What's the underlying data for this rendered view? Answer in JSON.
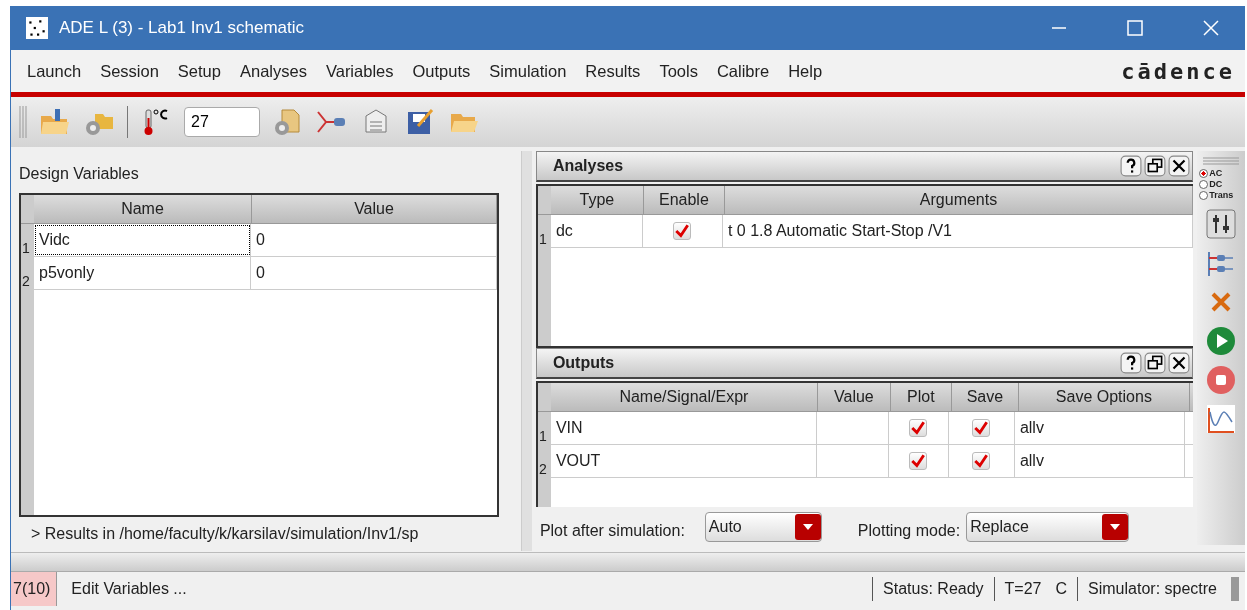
{
  "window": {
    "title": "ADE L (3) - Lab1 Inv1 schematic"
  },
  "menu": [
    "Launch",
    "Session",
    "Setup",
    "Analyses",
    "Variables",
    "Outputs",
    "Simulation",
    "Results",
    "Tools",
    "Calibre",
    "Help"
  ],
  "brand": "cādence",
  "toolbar": {
    "temperature": "27"
  },
  "design_variables": {
    "title": "Design Variables",
    "columns": [
      "Name",
      "Value"
    ],
    "rows": [
      {
        "index": "1",
        "name": "Vidc",
        "value": "0",
        "selected": true
      },
      {
        "index": "2",
        "name": "p5vonly",
        "value": "0",
        "selected": false
      }
    ]
  },
  "results_path": "> Results in /home/faculty/k/karsilav/simulation/Inv1/sp",
  "analyses": {
    "title": "Analyses",
    "columns": [
      "Type",
      "Enable",
      "Arguments"
    ],
    "rows": [
      {
        "index": "1",
        "type": "dc",
        "enabled": true,
        "arguments": "t 0 1.8 Automatic Start-Stop /V1"
      }
    ]
  },
  "outputs": {
    "title": "Outputs",
    "columns": [
      "Name/Signal/Expr",
      "Value",
      "Plot",
      "Save",
      "Save Options"
    ],
    "rows": [
      {
        "index": "1",
        "name": "VIN",
        "plot": true,
        "save": true,
        "save_options": "allv"
      },
      {
        "index": "2",
        "name": "VOUT",
        "plot": true,
        "save": true,
        "save_options": "allv"
      }
    ]
  },
  "plot_after_simulation": {
    "label": "Plot after simulation:",
    "value": "Auto"
  },
  "plotting_mode": {
    "label": "Plotting mode:",
    "value": "Replace"
  },
  "analysis_types": [
    {
      "label": "AC",
      "selected": true
    },
    {
      "label": "DC",
      "selected": false
    },
    {
      "label": "Trans",
      "selected": false
    }
  ],
  "status_bar": {
    "count": "7(10)",
    "message": "Edit Variables ...",
    "status": "Status: Ready",
    "temperature": "T=27",
    "unit": "C",
    "simulator": "Simulator: spectre"
  }
}
